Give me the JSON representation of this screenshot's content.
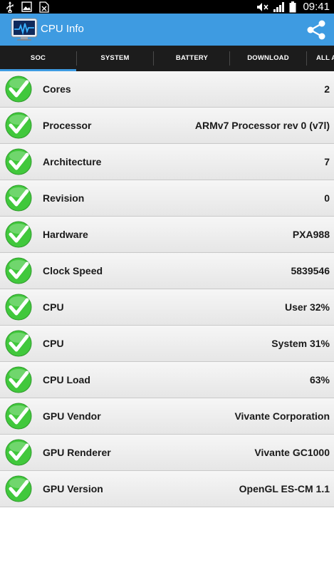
{
  "status_bar": {
    "time": "09:41",
    "left_icons": [
      "usb-icon",
      "image-icon",
      "file-excel-icon"
    ],
    "right_icons": [
      "mute-icon",
      "signal-icon",
      "battery-icon"
    ]
  },
  "app_bar": {
    "title": "CPU Info",
    "logo_icon": "cpu-monitor-icon",
    "share_icon": "share-icon"
  },
  "tabs": [
    {
      "label": "SOC",
      "selected": true
    },
    {
      "label": "SYSTEM",
      "selected": false
    },
    {
      "label": "BATTERY",
      "selected": false
    },
    {
      "label": "DOWNLOAD",
      "selected": false
    },
    {
      "label": "ALL A",
      "selected": false
    }
  ],
  "items": [
    {
      "label": "Cores",
      "value": "2"
    },
    {
      "label": "Processor",
      "value": "ARMv7 Processor rev 0 (v7l)"
    },
    {
      "label": "Architecture",
      "value": "7"
    },
    {
      "label": "Revision",
      "value": "0"
    },
    {
      "label": "Hardware",
      "value": "PXA988"
    },
    {
      "label": "Clock Speed",
      "value": "5839546"
    },
    {
      "label": "CPU",
      "value": "User 32%"
    },
    {
      "label": "CPU",
      "value": "System 31%"
    },
    {
      "label": "CPU Load",
      "value": "63%"
    },
    {
      "label": "GPU Vendor",
      "value": "Vivante Corporation"
    },
    {
      "label": "GPU Renderer",
      "value": "Vivante GC1000"
    },
    {
      "label": "GPU Version",
      "value": "OpenGL ES-CM 1.1"
    }
  ],
  "colors": {
    "accent": "#3e9be1",
    "tab_bar": "#1c1c1c",
    "check_green": "#3cc43a"
  }
}
